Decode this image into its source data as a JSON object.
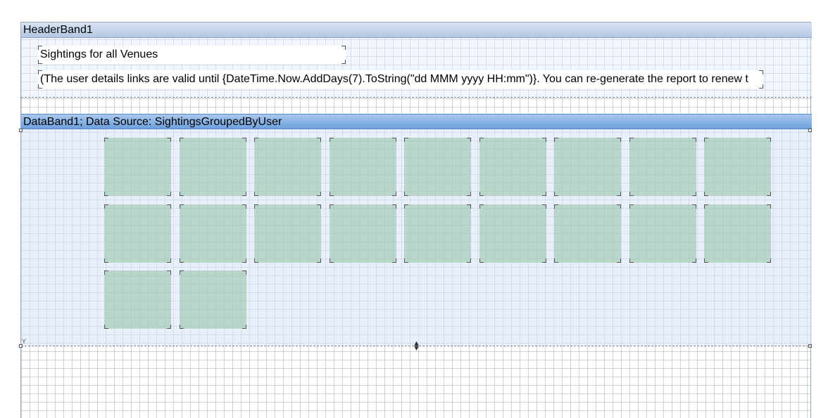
{
  "header_band": {
    "title": "HeaderBand1",
    "title_text": "Sightings for all Venues",
    "note_text": "(The user details links are valid until {DateTime.Now.AddDays(7).ToString(\"dd MMM yyyy HH:mm\")}. You can re-generate the report to renew t"
  },
  "data_band": {
    "title": "DataBand1; Data Source: SightingsGroupedByUser",
    "cell_count": 20
  },
  "colors": {
    "header_band": "#b3c7e3",
    "data_band": "#6ea0de",
    "cell": "#a0c8af"
  },
  "icons": {
    "resize": "resize-vertical-icon"
  }
}
